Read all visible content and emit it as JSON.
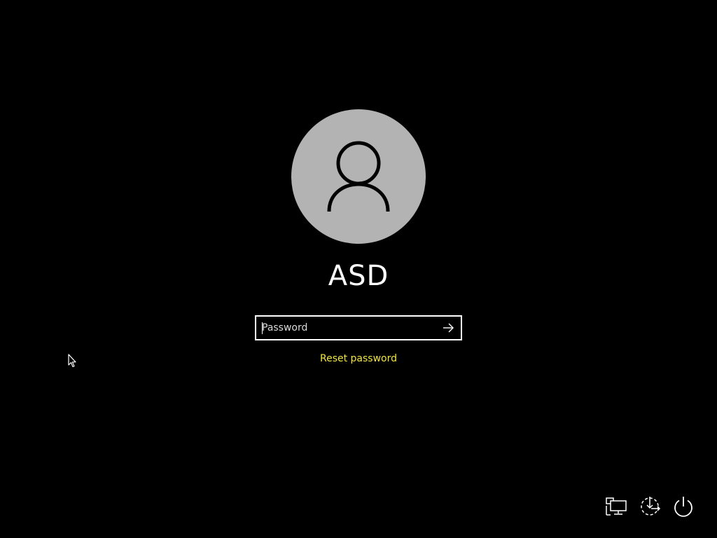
{
  "user": {
    "name": "ASD",
    "avatar_icon": "user-silhouette-icon",
    "avatar_bg": "#b3b3b3"
  },
  "password": {
    "placeholder": "Password",
    "value": "",
    "submit_icon": "arrow-right-icon"
  },
  "reset_link": {
    "label": "Reset password",
    "color": "#f0e442"
  },
  "corner_controls": [
    {
      "name": "network",
      "icon": "network-icon"
    },
    {
      "name": "ease-of-access",
      "icon": "ease-of-access-icon"
    },
    {
      "name": "power",
      "icon": "power-icon"
    }
  ],
  "colors": {
    "background": "#000000",
    "foreground": "#ffffff"
  }
}
